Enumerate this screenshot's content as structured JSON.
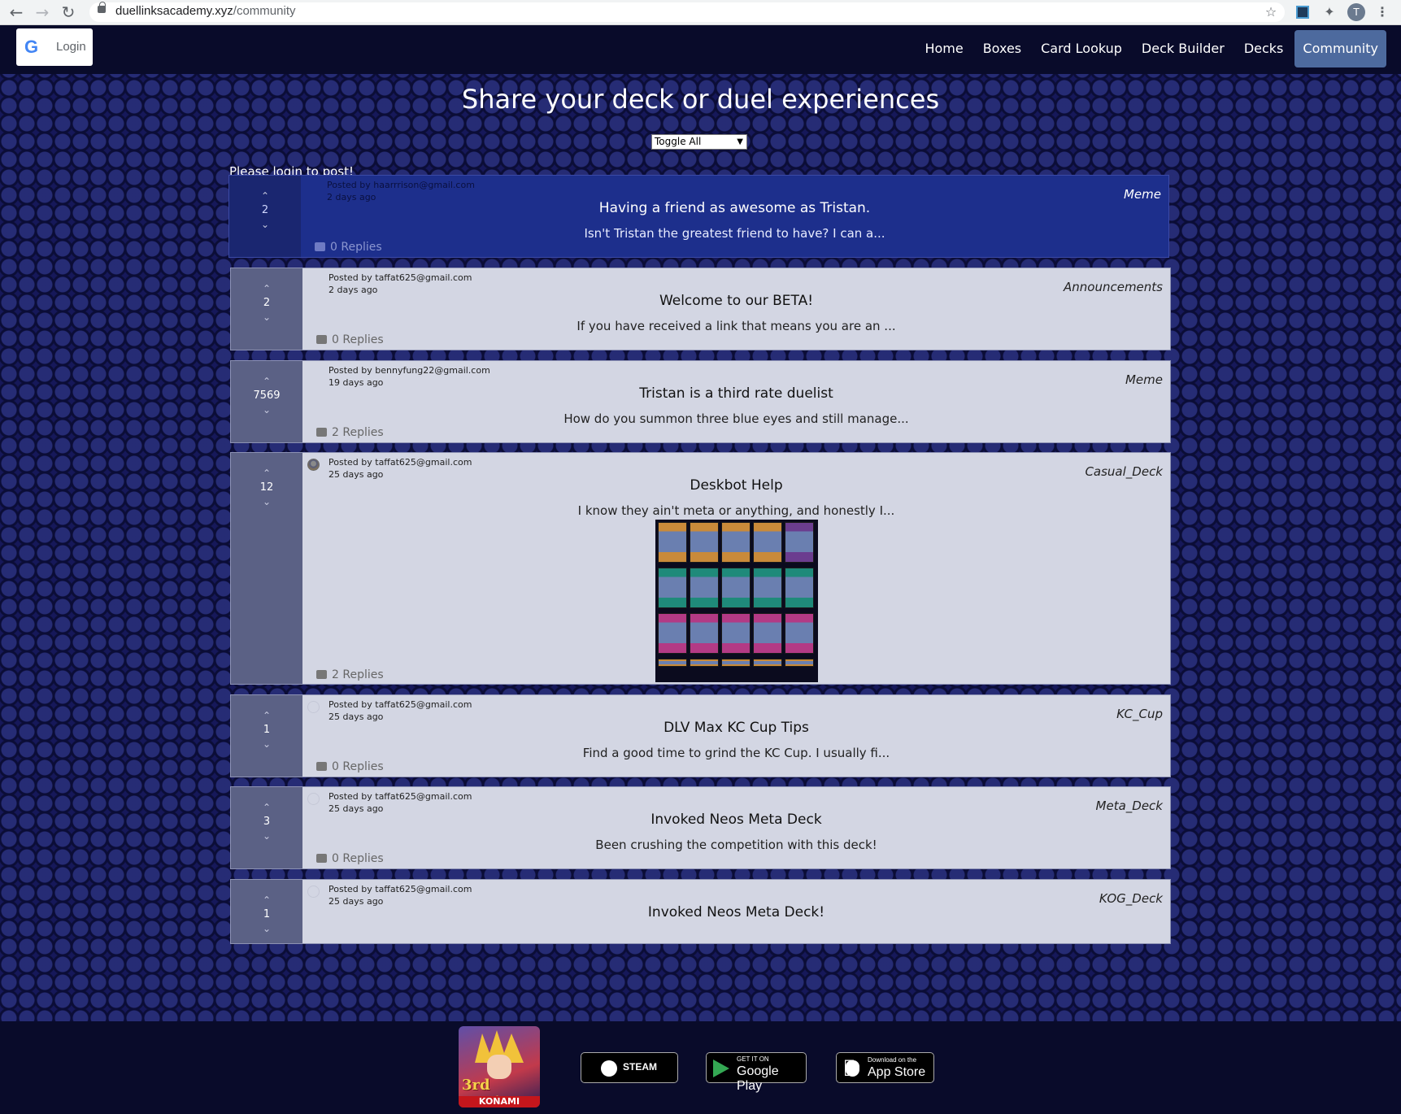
{
  "browser": {
    "url_host": "duellinksacademy.xyz",
    "url_path": "/community",
    "avatar_letter": "T",
    "icons": [
      "back-icon",
      "forward-icon",
      "reload-icon",
      "lock-icon",
      "bookmark-star-icon",
      "extension-icon",
      "puzzle-icon",
      "profile-avatar",
      "more-menu-icon"
    ]
  },
  "header": {
    "login_label": "Login",
    "google_glyph": "G",
    "nav": [
      {
        "label": "Home",
        "active": false
      },
      {
        "label": "Boxes",
        "active": false
      },
      {
        "label": "Card Lookup",
        "active": false
      },
      {
        "label": "Deck Builder",
        "active": false
      },
      {
        "label": "Decks",
        "active": false
      },
      {
        "label": "Community",
        "active": true
      }
    ]
  },
  "main": {
    "title": "Share your deck or duel experiences",
    "toggle_select": {
      "selected": "Toggle All"
    },
    "login_prompt": "Please login to post!"
  },
  "posts": [
    {
      "votes": "2",
      "author": "Posted by haarrrison@gmail.com",
      "time": "2 days ago",
      "category": "Meme",
      "title": "Having a friend as awesome as Tristan.",
      "excerpt": "Isn't Tristan the greatest friend to have? I can a...",
      "replies": "0 Replies",
      "highlight": true,
      "avatar": "none"
    },
    {
      "votes": "2",
      "author": "Posted by taffat625@gmail.com",
      "time": "2 days ago",
      "category": "Announcements",
      "title": "Welcome to our BETA!",
      "excerpt": "If you have received a link that means you are an ...",
      "replies": "0 Replies",
      "highlight": false,
      "avatar": "none"
    },
    {
      "votes": "7569",
      "author": "Posted by bennyfung22@gmail.com",
      "time": "19 days ago",
      "category": "Meme",
      "title": "Tristan is a third rate duelist",
      "excerpt": "How do you summon three blue eyes and still manage...",
      "replies": "2 Replies",
      "highlight": false,
      "avatar": "none"
    },
    {
      "votes": "12",
      "author": "Posted by taffat625@gmail.com",
      "time": "25 days ago",
      "category": "Casual_Deck",
      "title": "Deskbot Help",
      "excerpt": "I know they ain't meta or anything, and honestly I...",
      "replies": "2 Replies",
      "highlight": false,
      "avatar": "filled",
      "has_deck_image": true
    },
    {
      "votes": "1",
      "author": "Posted by taffat625@gmail.com",
      "time": "25 days ago",
      "category": "KC_Cup",
      "title": "DLV Max KC Cup Tips",
      "excerpt": "Find a good time to grind the KC Cup. I usually fi...",
      "replies": "0 Replies",
      "highlight": false,
      "avatar": "empty"
    },
    {
      "votes": "3",
      "author": "Posted by taffat625@gmail.com",
      "time": "25 days ago",
      "category": "Meta_Deck",
      "title": "Invoked Neos Meta Deck",
      "excerpt": "Been crushing the competition with this deck!",
      "replies": "0 Replies",
      "highlight": false,
      "avatar": "empty"
    },
    {
      "votes": "1",
      "author": "Posted by taffat625@gmail.com",
      "time": "25 days ago",
      "category": "KOG_Deck",
      "title": "Invoked Neos Meta Deck!",
      "excerpt": "",
      "replies": "",
      "highlight": false,
      "avatar": "empty"
    }
  ],
  "footer": {
    "app_icon": {
      "badge": "3rd Anniv.",
      "publisher": "KONAMI"
    },
    "steam": {
      "label": "STEAM"
    },
    "google_play": {
      "small": "GET IT ON",
      "big": "Google Play"
    },
    "app_store": {
      "small": "Download on the",
      "big": "App Store"
    }
  },
  "colors": {
    "nav_bg": "#090b2a",
    "page_bg": "#16185a",
    "active_nav": "#4d6a9e",
    "post_bg": "#d3d6e3",
    "post_highlight_bg": "#1d2f8c",
    "vote_bar": "#5b6185"
  }
}
